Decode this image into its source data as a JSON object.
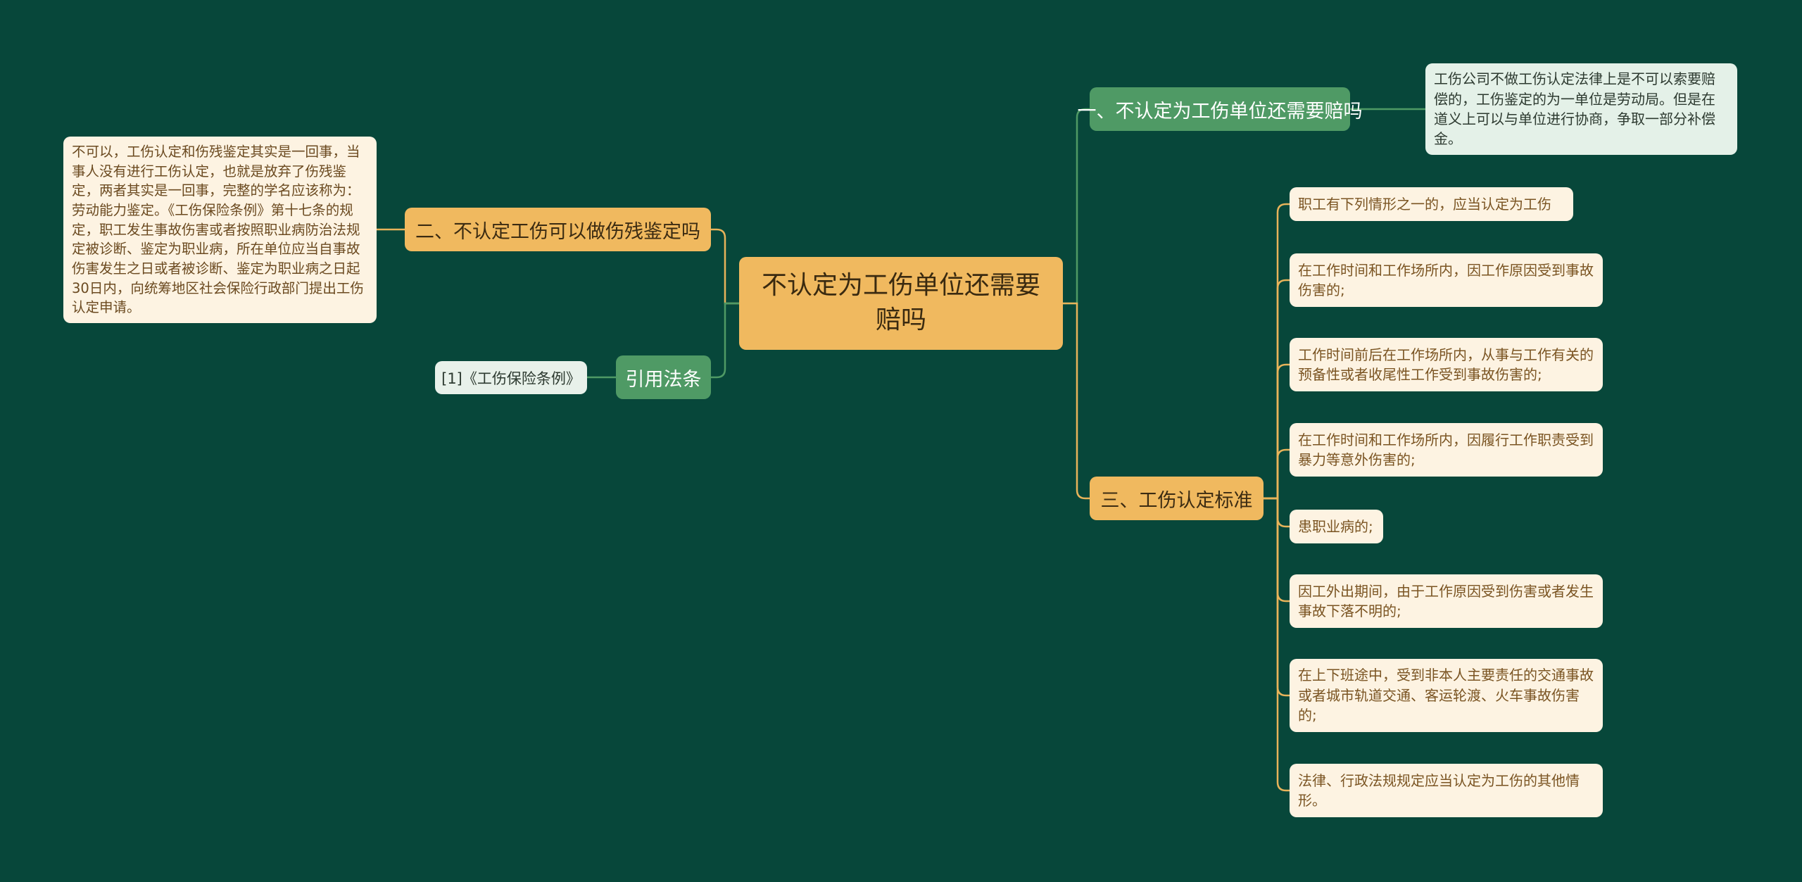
{
  "mindmap": {
    "root": "不认定为工伤单位还需要赔吗",
    "branches": {
      "b1": {
        "label": "一、不认定为工伤单位还需要赔吗",
        "detail": "工伤公司不做工伤认定法律上是不可以索要赔偿的，工伤鉴定的为一单位是劳动局。但是在道义上可以与单位进行协商，争取一部分补偿金。"
      },
      "b2": {
        "label": "二、不认定工伤可以做伤残鉴定吗",
        "detail": "不可以，工伤认定和伤残鉴定其实是一回事，当事人没有进行工伤认定，也就是放弃了伤残鉴定，两者其实是一回事，完整的学名应该称为：劳动能力鉴定。《工伤保险条例》第十七条的规定，职工发生事故伤害或者按照职业病防治法规定被诊断、鉴定为职业病，所在单位应当自事故伤害发生之日或者被诊断、鉴定为职业病之日起30日内，向统筹地区社会保险行政部门提出工伤认定申请。"
      },
      "b3": {
        "label": "三、工伤认定标准",
        "items": [
          "职工有下列情形之一的，应当认定为工伤",
          "在工作时间和工作场所内，因工作原因受到事故伤害的;",
          "工作时间前后在工作场所内，从事与工作有关的预备性或者收尾性工作受到事故伤害的;",
          "在工作时间和工作场所内，因履行工作职责受到暴力等意外伤害的;",
          "患职业病的;",
          "因工外出期间，由于工作原因受到伤害或者发生事故下落不明的;",
          "在上下班途中，受到非本人主要责任的交通事故或者城市轨道交通、客运轮渡、火车事故伤害的;",
          "法律、行政法规规定应当认定为工伤的其他情形。"
        ]
      },
      "refs": {
        "label": "引用法条",
        "items": [
          "[1]《工伤保险条例》"
        ]
      }
    }
  },
  "colors": {
    "background": "#07473a",
    "orange": "#f0b95f",
    "green": "#4f9a65",
    "cream": "#fdf3e2",
    "mint": "#e4f1e8",
    "link_orange": "#e8b35a",
    "link_green": "#4f9a65"
  }
}
